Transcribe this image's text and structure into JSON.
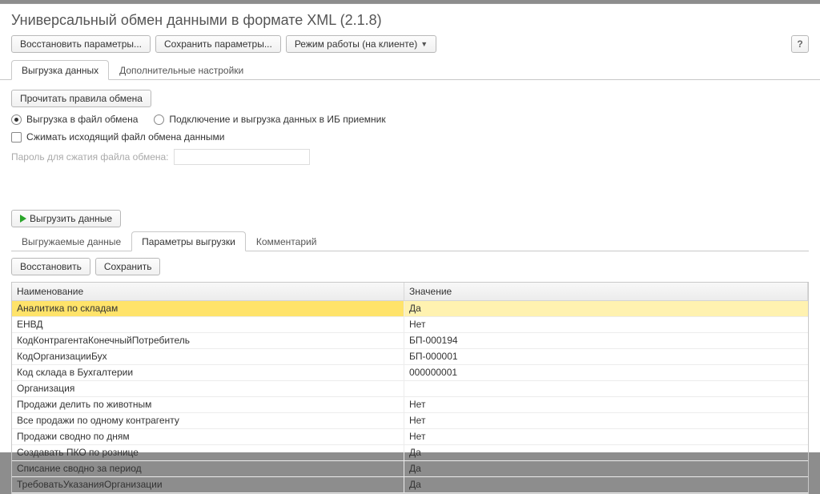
{
  "window": {
    "title": "Универсальный обмен данными в формате XML (2.1.8)"
  },
  "toolbar": {
    "restore_params": "Восстановить параметры...",
    "save_params": "Сохранить параметры...",
    "mode": "Режим работы (на клиенте)",
    "help": "?"
  },
  "main_tabs": [
    {
      "label": "Выгрузка данных",
      "active": true
    },
    {
      "label": "Дополнительные настройки",
      "active": false
    }
  ],
  "upload_panel": {
    "btn_read_rules": "Прочитать правила обмена",
    "radio_file": "Выгрузка в файл обмена",
    "radio_ib": "Подключение и выгрузка данных в ИБ приемник",
    "chk_compress": "Сжимать исходящий файл обмена данными",
    "pwd_label": "Пароль для сжатия файла обмена:",
    "pwd_value": "",
    "btn_export": "Выгрузить данные"
  },
  "inner_tabs": [
    {
      "label": "Выгружаемые данные",
      "active": false
    },
    {
      "label": "Параметры выгрузки",
      "active": true
    },
    {
      "label": "Комментарий",
      "active": false
    }
  ],
  "params_toolbar": {
    "restore": "Восстановить",
    "save": "Сохранить"
  },
  "grid": {
    "col_name": "Наименование",
    "col_value": "Значение",
    "rows": [
      {
        "name": "Аналитика по складам",
        "value": "Да",
        "selected": true
      },
      {
        "name": "ЕНВД",
        "value": "Нет"
      },
      {
        "name": "КодКонтрагентаКонечныйПотребитель",
        "value": "БП-000194"
      },
      {
        "name": "КодОрганизацииБух",
        "value": "БП-000001"
      },
      {
        "name": "Код склада в Бухгалтерии",
        "value": "000000001"
      },
      {
        "name": "Организация",
        "value": ""
      },
      {
        "name": "Продажи делить по животным",
        "value": "Нет"
      },
      {
        "name": "Все продажи по одному контрагенту",
        "value": "Нет"
      },
      {
        "name": "Продажи сводно по дням",
        "value": "Нет"
      },
      {
        "name": "Создавать ПКО по рознице",
        "value": "Да"
      },
      {
        "name": "Списание сводно за период",
        "value": "Да"
      },
      {
        "name": "ТребоватьУказанияОрганизации",
        "value": "Да"
      }
    ]
  }
}
